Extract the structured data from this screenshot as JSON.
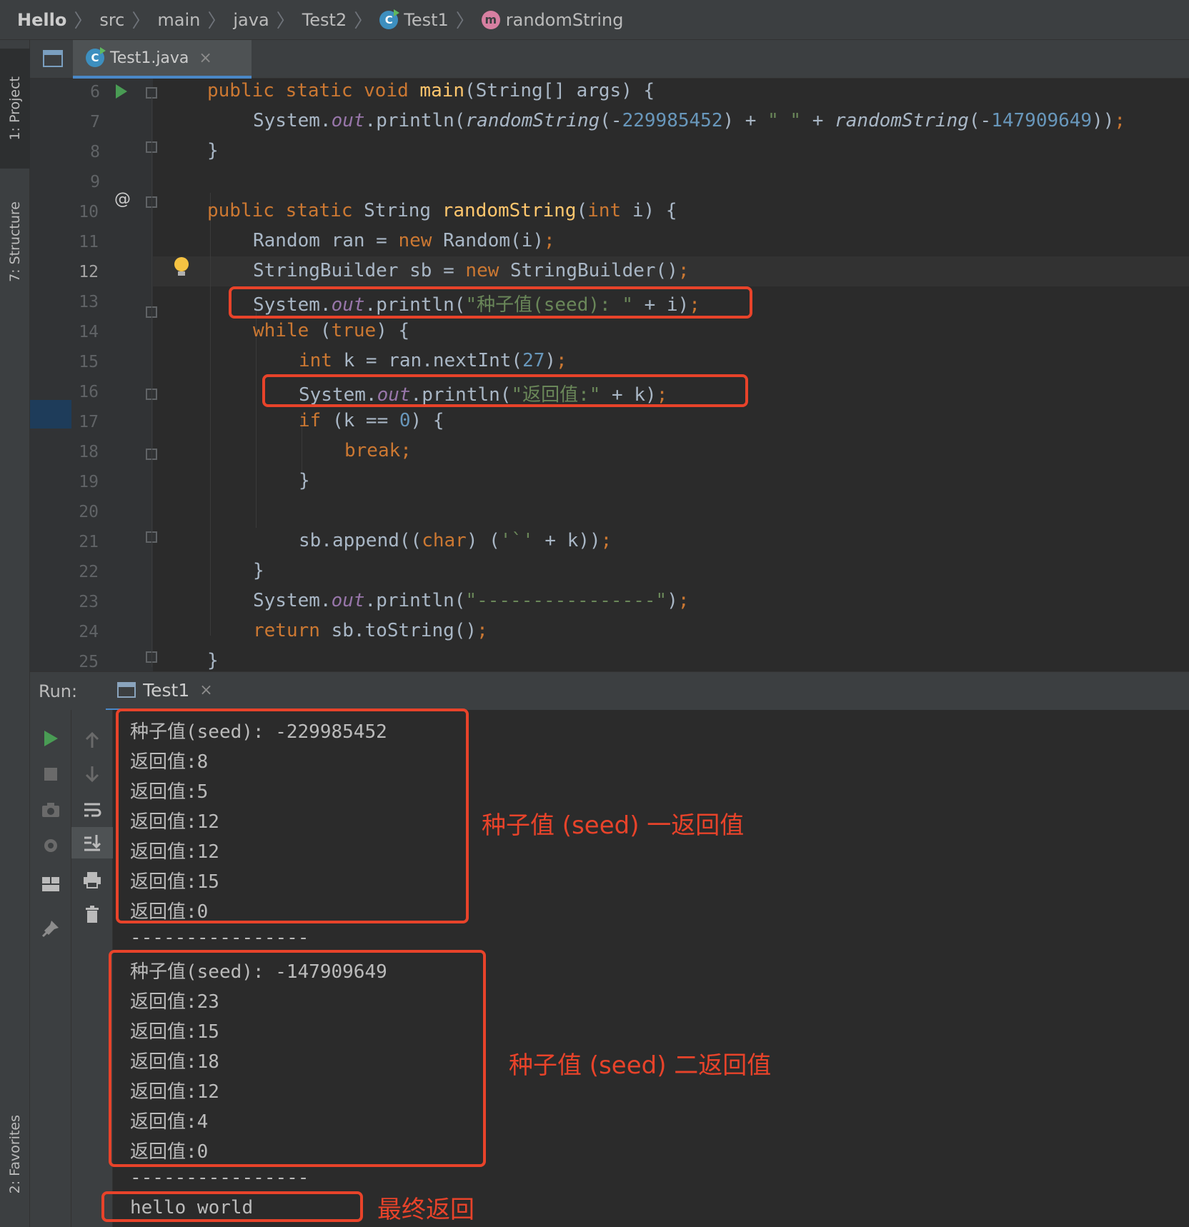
{
  "breadcrumb": {
    "items": [
      "Hello",
      "src",
      "main",
      "java",
      "Test2",
      "Test1",
      "randomString"
    ],
    "class_icon": "C",
    "method_icon": "m"
  },
  "left_strip": {
    "project": "1: Project",
    "structure": "7: Structure",
    "favorites": "2: Favorites"
  },
  "editor_tab": {
    "label": "Test1.java",
    "close": "×"
  },
  "editor": {
    "line_numbers": [
      "6",
      "7",
      "8",
      "9",
      "10",
      "11",
      "12",
      "13",
      "14",
      "15",
      "16",
      "17",
      "18",
      "19",
      "20",
      "21",
      "22",
      "23",
      "24",
      "25"
    ],
    "current_line": "12",
    "gutter_at": "@"
  },
  "run": {
    "label": "Run:",
    "tab": "Test1",
    "close": "×",
    "output": [
      "种子值(seed): -229985452",
      "返回值:8",
      "返回值:5",
      "返回值:12",
      "返回值:12",
      "返回值:15",
      "返回值:0",
      "----------------",
      "种子值(seed): -147909649",
      "返回值:23",
      "返回值:15",
      "返回值:18",
      "返回值:12",
      "返回值:4",
      "返回值:0",
      "----------------",
      "hello world"
    ]
  },
  "annotations": {
    "seed1": "种子值 (seed) 一返回值",
    "seed2": "种子值 (seed) 二返回值",
    "final": "最终返回"
  },
  "colors": {
    "accent_red": "#e8432a",
    "keyword": "#cc7832",
    "function": "#ffc66d",
    "string": "#6a8759",
    "number": "#6897bb",
    "field": "#9876aa"
  }
}
